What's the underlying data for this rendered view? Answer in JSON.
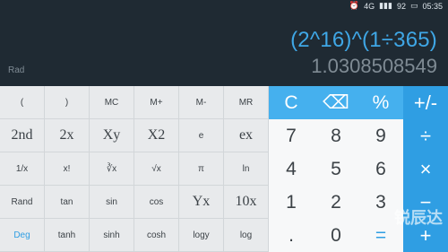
{
  "statusbar": {
    "alarm_icon": "alarm-icon",
    "network_label": "4G",
    "signal_icon": "signal-icon",
    "battery_level": "92",
    "time": "05:35"
  },
  "display": {
    "angle_mode": "Rad",
    "expression": "(2^16)^(1÷365)",
    "result": "1.0308508549"
  },
  "sci_keys": [
    [
      "(",
      ")",
      "MC",
      "M+",
      "M-",
      "MR"
    ],
    [
      "2nd",
      "2x",
      "Xy",
      "X2",
      "e",
      "ex"
    ],
    [
      "1/x",
      "x!",
      "∛x",
      "√x",
      "π",
      "ln"
    ],
    [
      "Rand",
      "tan",
      "sin",
      "cos",
      "Yx",
      "10x"
    ],
    [
      "Deg",
      "tanh",
      "sinh",
      "cosh",
      "logy",
      "log"
    ]
  ],
  "num_keys": [
    [
      "C",
      "⌫",
      "%"
    ],
    [
      "7",
      "8",
      "9"
    ],
    [
      "4",
      "5",
      "6"
    ],
    [
      "1",
      "2",
      "3"
    ],
    [
      ".",
      "0",
      "="
    ]
  ],
  "op_keys": [
    "+/-",
    "÷",
    "×",
    "−",
    "+"
  ],
  "watermark": "锐辰达",
  "colors": {
    "accent": "#2f9ee3",
    "display_bg": "#1f2a33",
    "sci_bg": "#e8eaec",
    "num_bg": "#f7f8f9"
  }
}
